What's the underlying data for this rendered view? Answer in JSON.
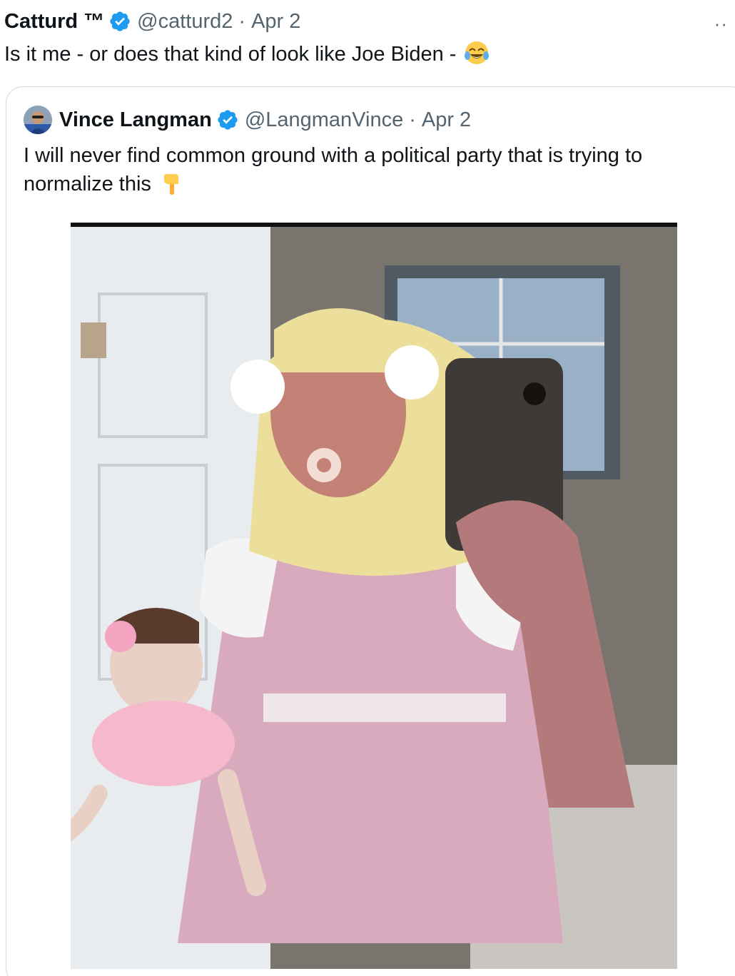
{
  "tweet": {
    "author_name": "Catturd ™",
    "handle": "@catturd2",
    "separator": "·",
    "date": "Apr 2",
    "text": "Is it me - or does that kind of look like Joe Biden - ",
    "emoji": "face-with-tears-of-joy",
    "more_label": "··"
  },
  "quoted_tweet": {
    "author_name": "Vince Langman",
    "handle": "@LangmanVince",
    "separator": "·",
    "date": "Apr 2",
    "text": "I will never find common ground with a political party that is trying to normalize this ",
    "emoji": "backhand-index-pointing-down"
  },
  "colors": {
    "verified_badge": "#1d9bf0",
    "muted_text": "#536471",
    "card_border": "#cfd9de"
  }
}
